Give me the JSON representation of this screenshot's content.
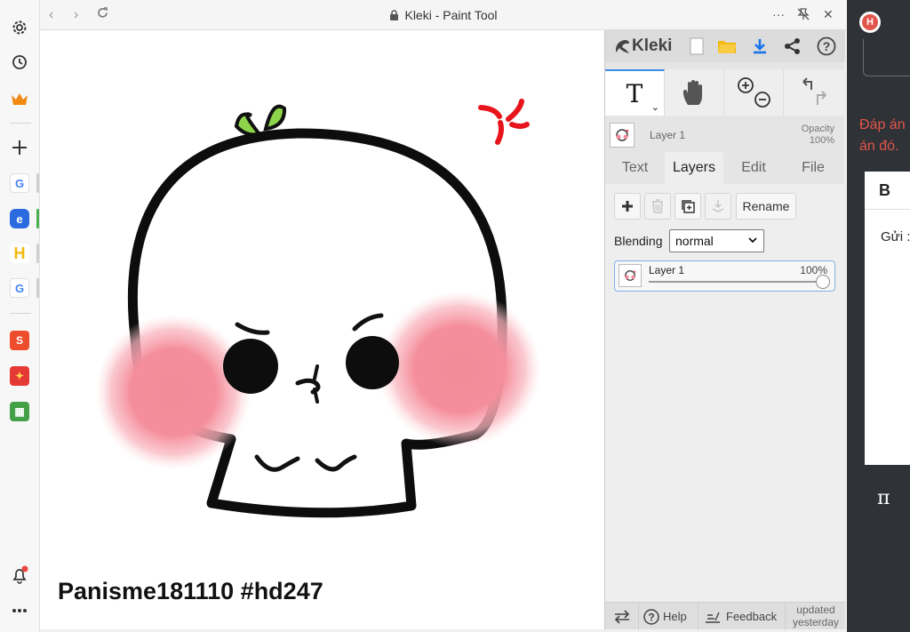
{
  "window": {
    "title": "Kleki - Paint Tool"
  },
  "canvas": {
    "caption": "Panisme181110 #hd247"
  },
  "kleki": {
    "logo_text": "Kleki",
    "header_icons": [
      "new-image-icon",
      "open-folder-icon",
      "download-icon",
      "share-icon",
      "help-icon"
    ],
    "tools": [
      "text-tool",
      "hand-tool",
      "zoom-tool",
      "undo-redo"
    ],
    "text_tool_glyph": "T",
    "layer_info": {
      "name": "Layer 1",
      "opacity_label": "Opacity",
      "opacity_value": "100%"
    },
    "tabs": [
      {
        "label": "Text",
        "active": false
      },
      {
        "label": "Layers",
        "active": true
      },
      {
        "label": "Edit",
        "active": false
      },
      {
        "label": "File",
        "active": false
      }
    ],
    "layers_tab": {
      "rename_label": "Rename",
      "blending_label": "Blending",
      "blending_value": "normal",
      "layers": [
        {
          "name": "Layer 1",
          "opacity": "100%"
        }
      ],
      "opacity_fraction": 1.0
    },
    "footer": {
      "help_label": "Help",
      "feedback_label": "Feedback",
      "updated_line1": "updated",
      "updated_line2": "yesterday"
    }
  },
  "background_page": {
    "text_line1": "Đáp án",
    "text_line2": "án đó.",
    "bold_button": "B",
    "editor_text": "Gửi :",
    "pi_symbol": "π"
  },
  "colors": {
    "accent_blue": "#3b8ee6",
    "download_blue": "#1a73e8",
    "folder_yellow": "#f2b90f",
    "angry_red": "#e8141c",
    "blush_pink": "#f28a98",
    "sprout_green": "#8ed44a"
  }
}
